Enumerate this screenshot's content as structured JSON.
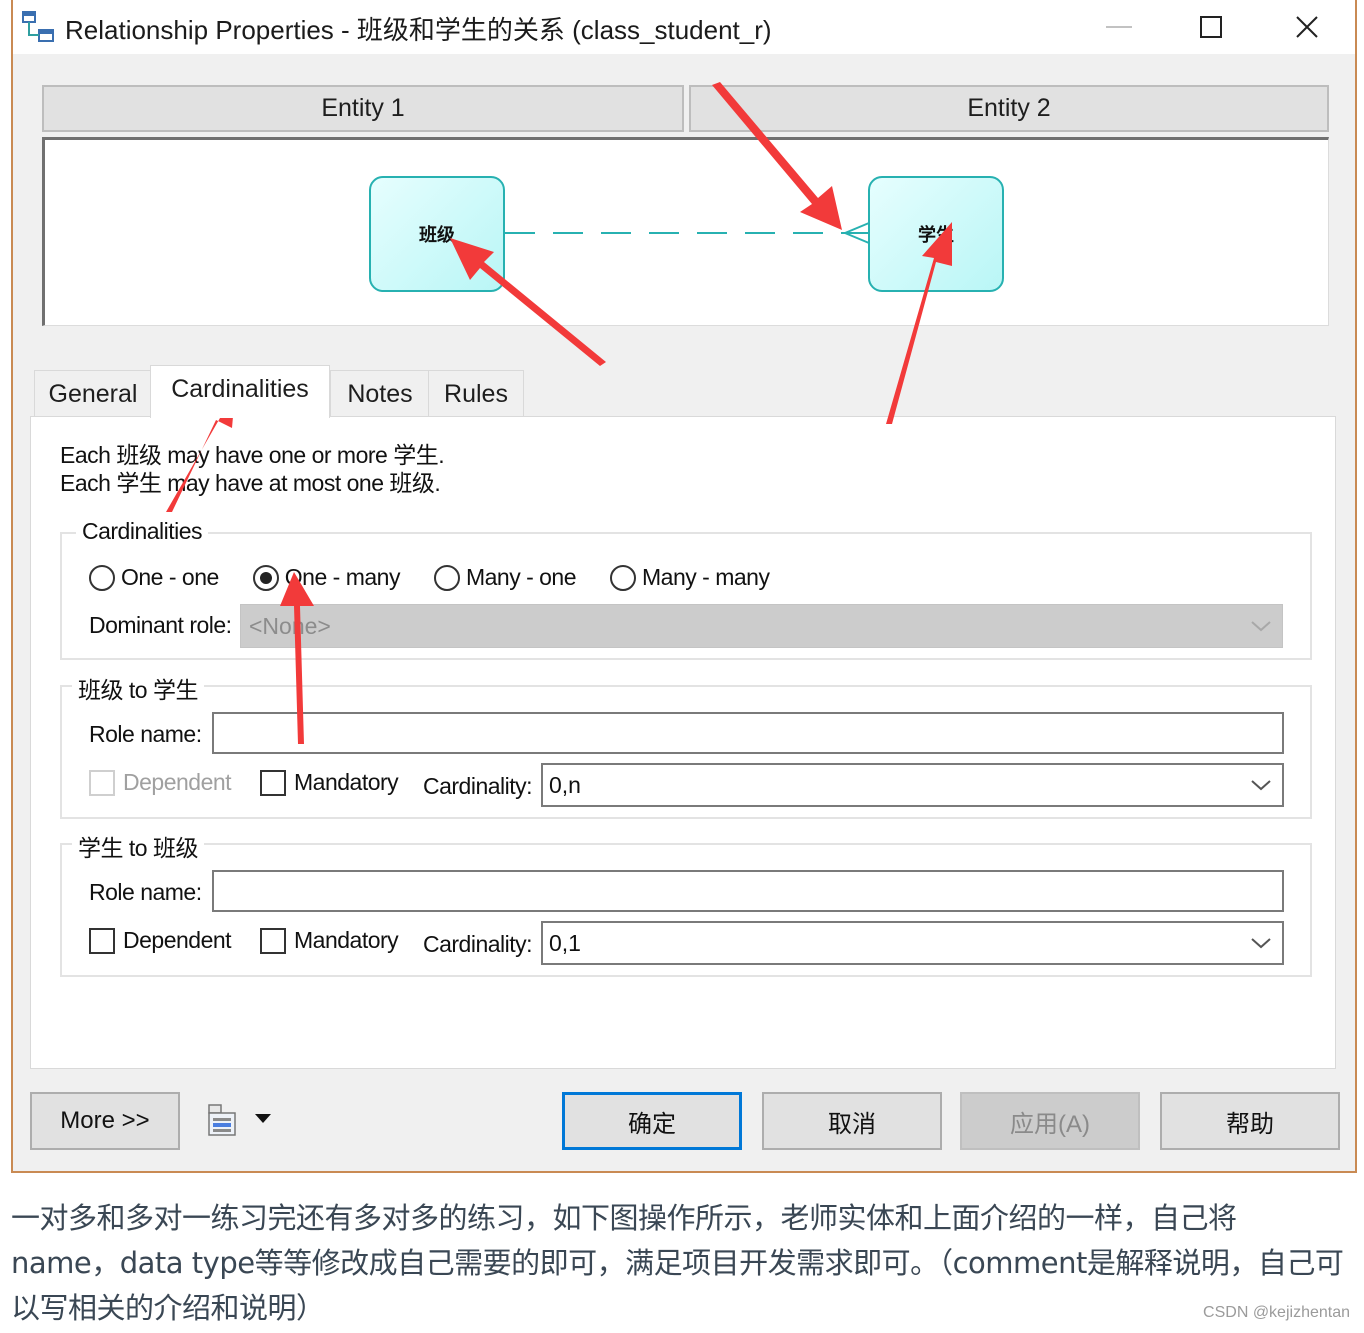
{
  "window": {
    "title": "Relationship Properties - 班级和学生的关系 (class_student_r)",
    "controls": {
      "minimize": "minimize",
      "maximize": "maximize",
      "close": "close"
    }
  },
  "entities": {
    "entity1_header": "Entity 1",
    "entity2_header": "Entity 2",
    "entity1_name": "班级",
    "entity2_name": "学生",
    "colors": {
      "box_border": "#27b1b1",
      "box_fill": "#c8f8f8",
      "link": "#27b1b1"
    }
  },
  "tabs": [
    {
      "label": "General",
      "active": false
    },
    {
      "label": "Cardinalities",
      "active": true
    },
    {
      "label": "Notes",
      "active": false
    },
    {
      "label": "Rules",
      "active": false
    }
  ],
  "cardinalities_tab": {
    "description_line1": "Each 班级 may have one or more 学生.",
    "description_line2": "Each 学生 may have at most one 班级.",
    "cardinalities_group": {
      "legend": "Cardinalities",
      "options": [
        {
          "label": "One - one",
          "checked": false
        },
        {
          "label": "One - many",
          "checked": true
        },
        {
          "label": "Many - one",
          "checked": false
        },
        {
          "label": "Many - many",
          "checked": false
        }
      ],
      "dominant_role_label": "Dominant role:",
      "dominant_role_value": "<None>"
    },
    "role1": {
      "legend": "班级 to 学生",
      "role_name_label": "Role name:",
      "role_name_value": "",
      "dependent_label": "Dependent",
      "dependent_checked": false,
      "dependent_enabled": false,
      "mandatory_label": "Mandatory",
      "mandatory_checked": false,
      "cardinality_label": "Cardinality:",
      "cardinality_value": "0,n"
    },
    "role2": {
      "legend": "学生 to 班级",
      "role_name_label": "Role name:",
      "role_name_value": "",
      "dependent_label": "Dependent",
      "dependent_checked": false,
      "dependent_enabled": true,
      "mandatory_label": "Mandatory",
      "mandatory_checked": false,
      "cardinality_label": "Cardinality:",
      "cardinality_value": "0,1"
    }
  },
  "footer": {
    "more_button": "More >>",
    "toolbar_icon": "property-sheet-icon",
    "ok_button": "确定",
    "cancel_button": "取消",
    "apply_button": "应用(A)",
    "help_button": "帮助"
  },
  "article": {
    "text": "一对多和多对一练习完还有多对多的练习，如下图操作所示，老师实体和上面介绍的一样，自己将name，data type等等修改成自己需要的即可，满足项目开发需求即可。（comment是解释说明，自己可以写相关的介绍和说明）",
    "line1": "一对多和多对一练习完还有多对多的练习，如下图操作所示，老师实体和上面介绍的一样，自己将",
    "line2": "name，data type等等修改成自己需要的即可，满足项目开发需求即可。（comment是解释说明，自己可",
    "line3": "以写相关的介绍和说明）"
  },
  "watermark": "CSDN @kejizhentan",
  "annotation_color": "#f23a3a"
}
